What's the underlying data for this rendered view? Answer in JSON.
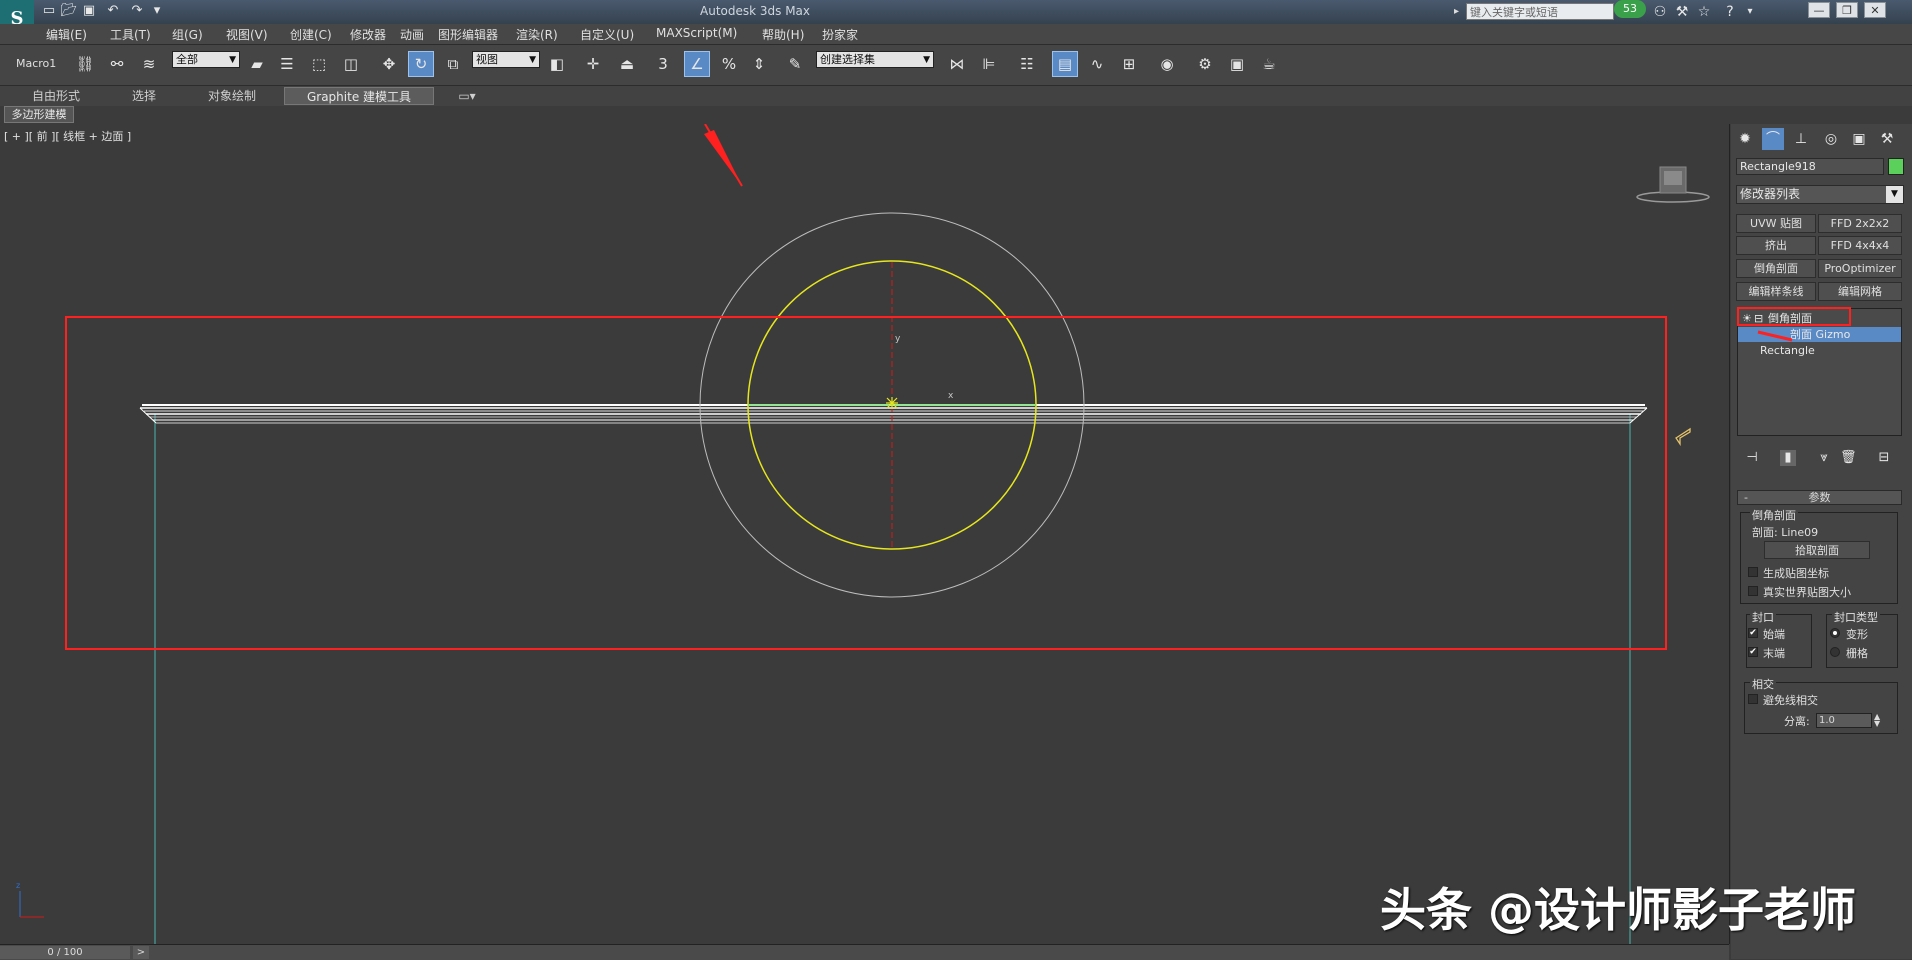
{
  "window": {
    "title": "Autodesk 3ds Max",
    "search_placeholder": "键入关键字或短语",
    "badge_count": "53"
  },
  "menus": [
    "编辑(E)",
    "工具(T)",
    "组(G)",
    "视图(V)",
    "创建(C)",
    "修改器",
    "动画",
    "图形编辑器",
    "渲染(R)",
    "自定义(U)",
    "MAXScript(M)",
    "帮助(H)",
    "扮家家"
  ],
  "toolbar": {
    "macro_label": "Macro1",
    "selection_filter": "全部",
    "coord_system": "视图",
    "snap_toggle_label": "3",
    "named_selection": "创建选择集"
  },
  "ribbon": {
    "tabs": [
      "自由形式",
      "选择",
      "对象绘制",
      "Graphite 建模工具"
    ],
    "active_tab": "Graphite 建模工具",
    "sub_tab": "多边形建模"
  },
  "viewport": {
    "label": "[ + ][ 前 ][ 线框 + 边面 ]",
    "frame_counter": "0 / 100",
    "next_button": ">"
  },
  "command_panel": {
    "object_name": "Rectangle918",
    "object_color": "#5bd15b",
    "modifier_list": "修改器列表",
    "modifier_buttons": [
      "UVW 贴图",
      "FFD 2x2x2",
      "挤出",
      "FFD 4x4x4",
      "倒角剖面",
      "ProOptimizer",
      "编辑样条线",
      "编辑网格"
    ],
    "stack": {
      "modifier": "倒角剖面",
      "sub_object": "剖面 Gizmo",
      "base_object": "Rectangle"
    },
    "parameters": {
      "rollout_title": "参数",
      "group_bevel_profile": "倒角剖面",
      "profile_label": "剖面: Line09",
      "pick_profile_button": "拾取剖面",
      "gen_mapping_coords": "生成贴图坐标",
      "real_world_map_size": "真实世界贴图大小",
      "capping_title": "封口",
      "cap_start": "始端",
      "cap_end": "末端",
      "cap_type_title": "封口类型",
      "cap_type_morph": "变形",
      "cap_type_grid": "栅格",
      "intersections_title": "相交",
      "avoid_self_intersect": "避免线相交",
      "separation_label": "分离:",
      "separation_value": "1.0"
    }
  },
  "watermark": "头条 @设计师影子老师",
  "annotation_color": "#ff2020"
}
